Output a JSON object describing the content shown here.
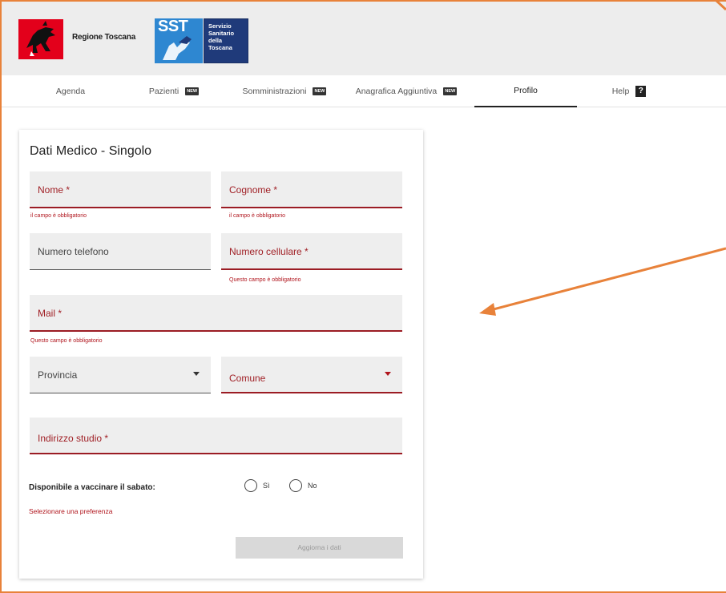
{
  "header": {
    "region_name": "Regione Toscana",
    "sst_abbr": "SST",
    "sst_lines": [
      "Servizio",
      "Sanitario",
      "della",
      "Toscana"
    ]
  },
  "nav": {
    "tabs": [
      {
        "label": "Agenda",
        "badge": ""
      },
      {
        "label": "Pazienti",
        "badge": "NEW"
      },
      {
        "label": "Somministrazioni",
        "badge": "NEW"
      },
      {
        "label": "Anagrafica Aggiuntiva",
        "badge": "NEW"
      },
      {
        "label": "Profilo",
        "badge": ""
      },
      {
        "label": "Help",
        "badge": ""
      }
    ],
    "active_tab": "Profilo",
    "help_icon": "question-icon",
    "help_glyph": "?"
  },
  "card": {
    "title": "Dati Medico - Singolo",
    "fields": {
      "nome": {
        "label": "Nome *",
        "error": "il campo è obbligatorio"
      },
      "cognome": {
        "label": "Cognome *",
        "error": "il campo è obbligatorio"
      },
      "telefono": {
        "label": "Numero telefono"
      },
      "cellulare": {
        "label": "Numero cellulare *",
        "error": "Questo campo è obbligatorio"
      },
      "mail": {
        "label": "Mail *",
        "error": "Questo campo è obbligatorio"
      },
      "provincia": {
        "label": "Provincia"
      },
      "comune": {
        "label": "Comune"
      },
      "indirizzo": {
        "label": "Indirizzo studio *"
      }
    },
    "saturday": {
      "label": "Disponibile a vaccinare il sabato:",
      "options": [
        "Sì",
        "No"
      ],
      "error": "Selezionare una preferenza"
    },
    "submit_label": "Aggiorna i dati"
  },
  "colors": {
    "error": "#b0141c",
    "annotation": "#e8823a",
    "sst_blue": "#2e87d1",
    "sst_navy": "#1f3a7a",
    "region_red": "#e3001b"
  }
}
